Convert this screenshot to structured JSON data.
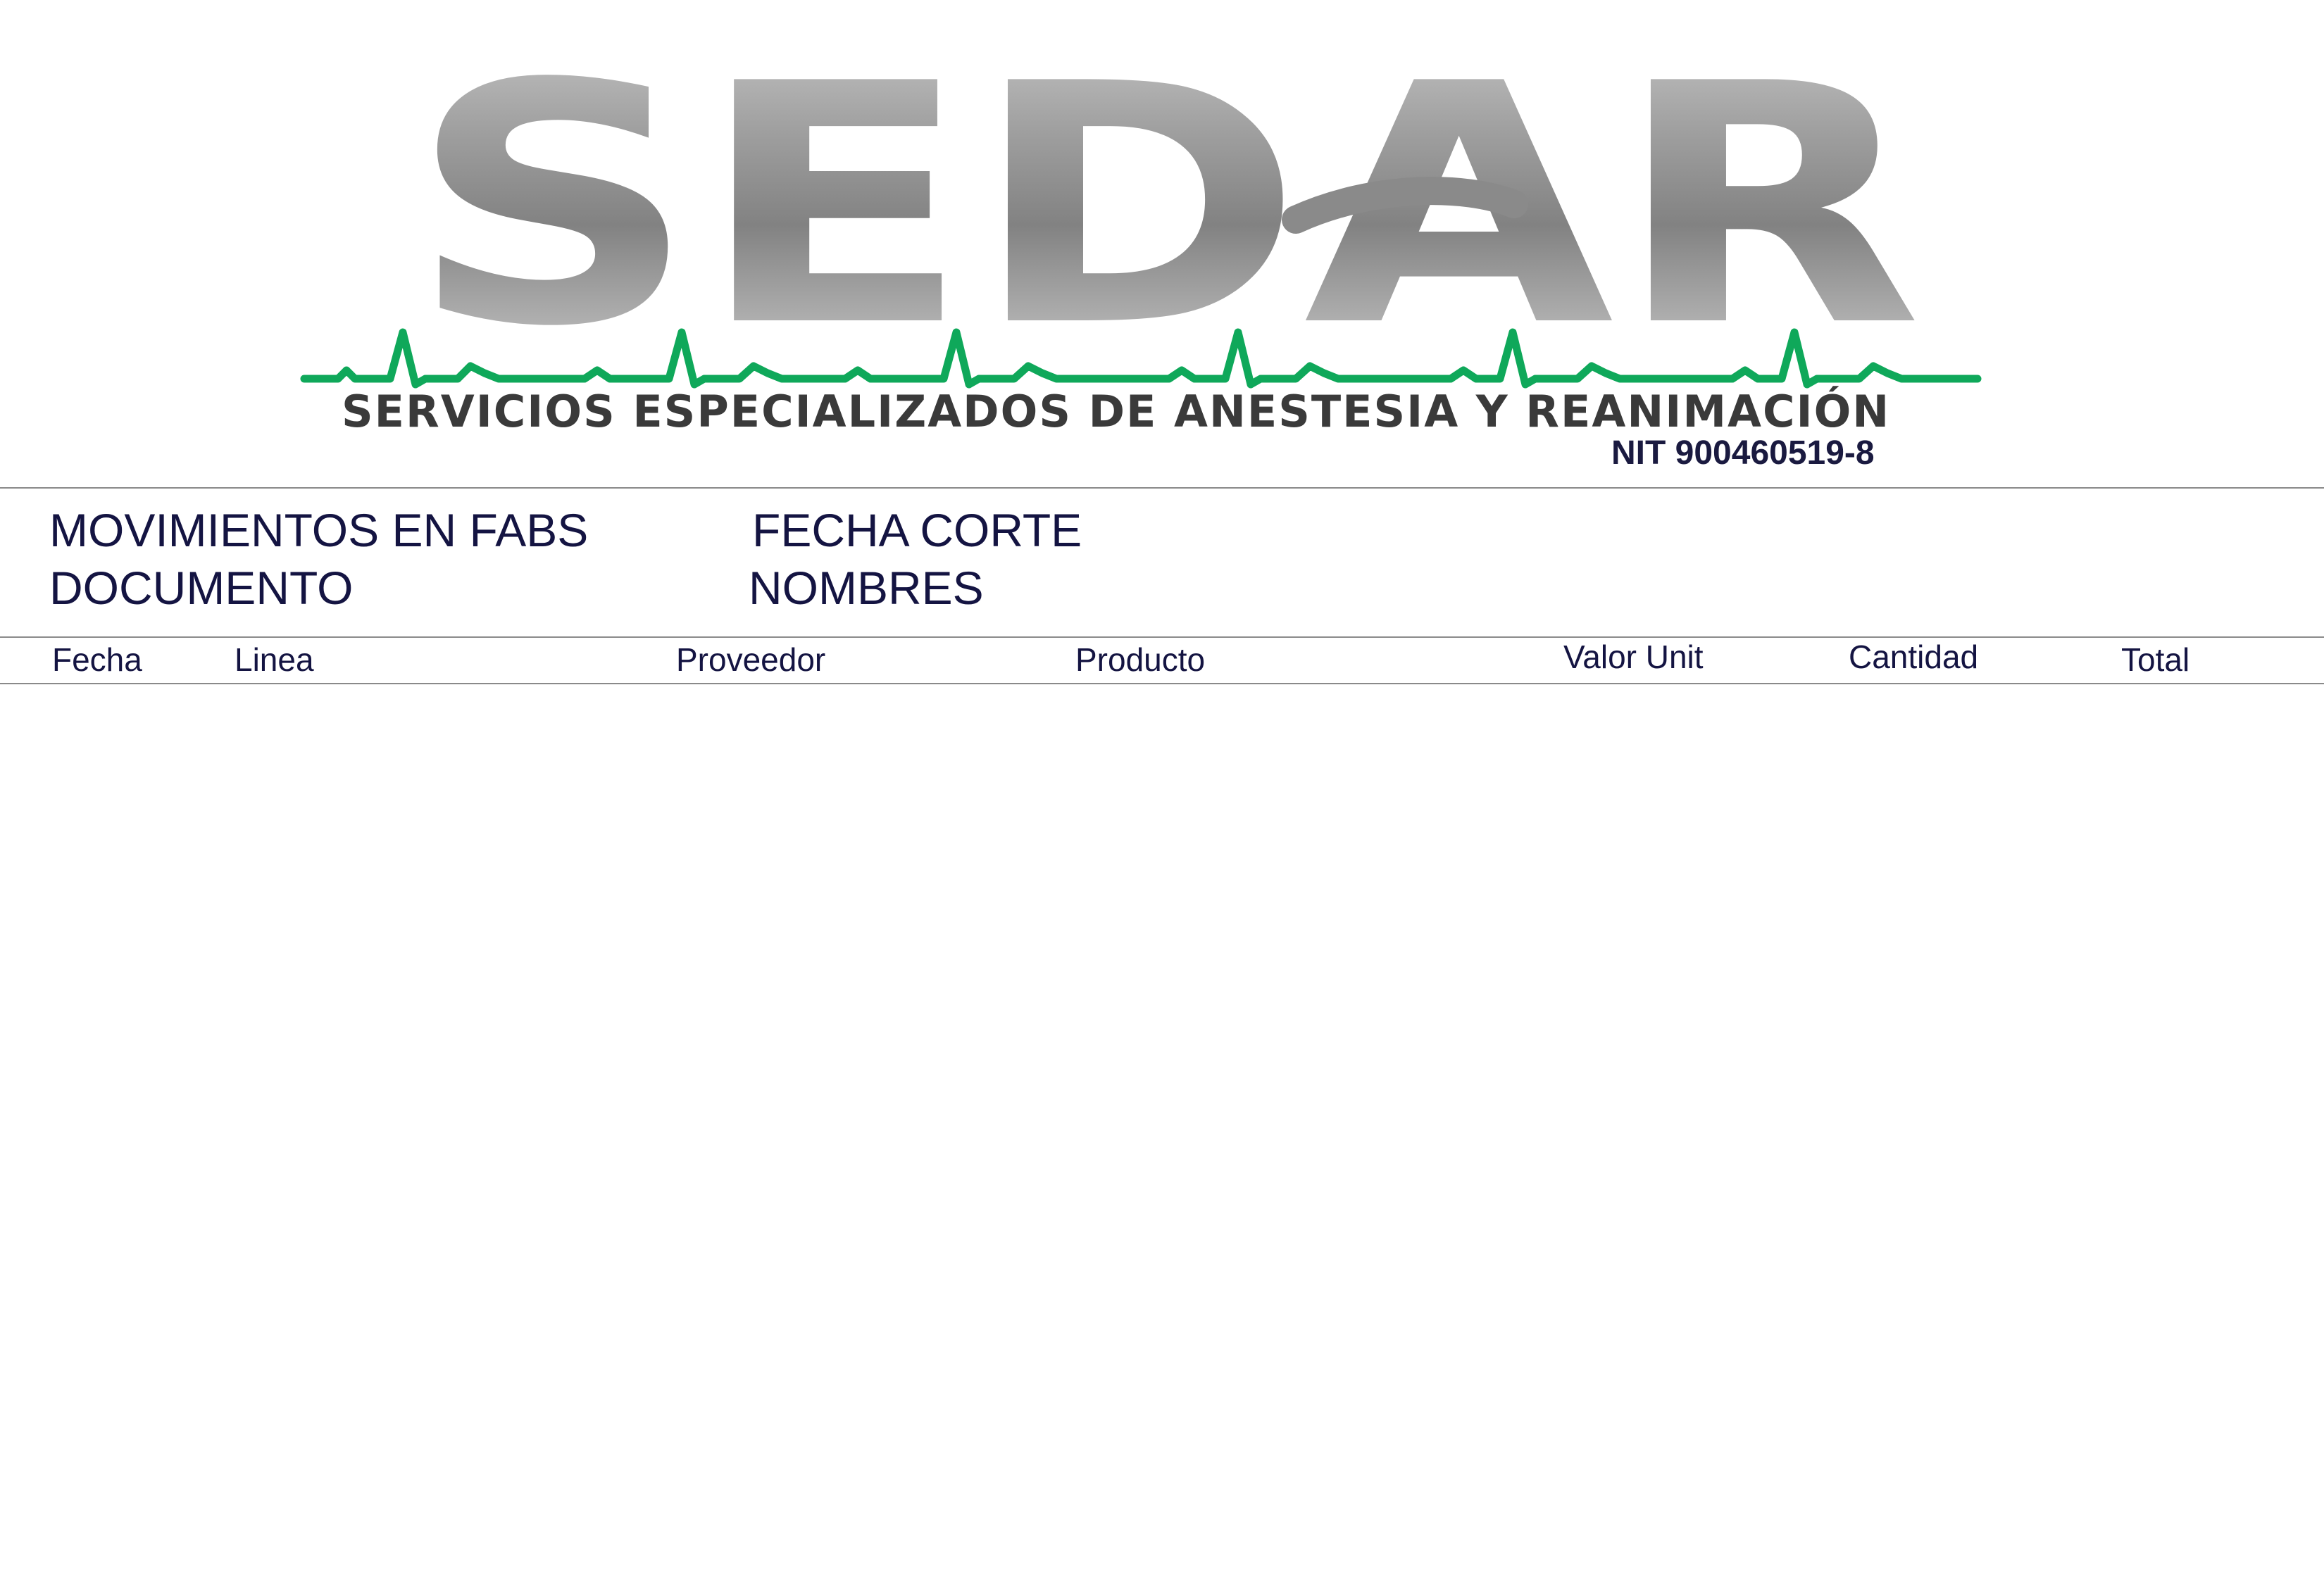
{
  "header": {
    "logo_text": "SEDAR",
    "subtitle": "SERVICIOS ESPECIALIZADOS DE ANESTESIA Y REANIMACIÓN",
    "nit": "NIT 900460519-8",
    "colors": {
      "logo_gray": "#8c8c8c",
      "pulse_green": "#0fa85a",
      "text_dark": "#141442"
    }
  },
  "info": {
    "title": "MOVIMIENTOS EN FABS",
    "fecha_corte_label": "FECHA CORTE",
    "documento_label": "DOCUMENTO",
    "nombres_label": "NOMBRES"
  },
  "table": {
    "columns": [
      "Fecha",
      "Linea",
      "Proveedor",
      "Producto",
      "Valor Unit",
      "Cantidad",
      "Total"
    ],
    "rows": []
  }
}
